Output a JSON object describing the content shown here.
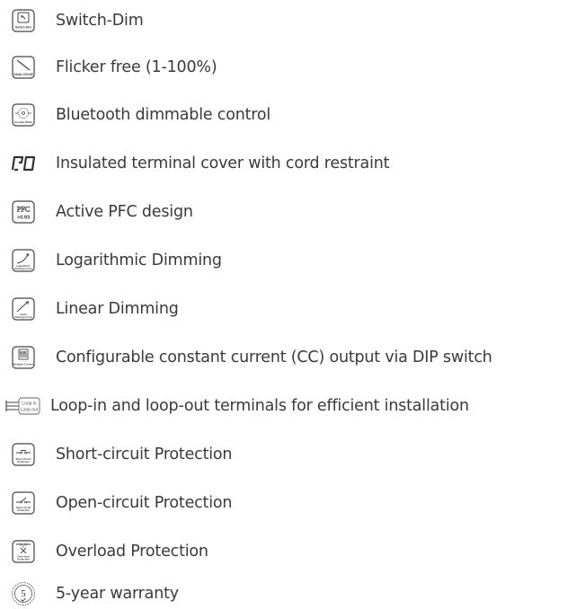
{
  "features": [
    {
      "icon": "switch-dim-icon",
      "icon_text": "Switch-Dim",
      "text": "Switch-Dim"
    },
    {
      "icon": "analogue-icon",
      "icon_text": "ANALOGUE",
      "text": "Flicker free (1-100%)"
    },
    {
      "icon": "bluetooth-tunable-white-icon",
      "icon_text": "Tunable White",
      "text": "Bluetooth dimmable control"
    },
    {
      "icon": "terminal-cover-icon",
      "icon_text": "",
      "text": "Insulated terminal cover with cord restraint"
    },
    {
      "icon": "pfc-icon",
      "icon_text": ">0.93",
      "text": "Active PFC design"
    },
    {
      "icon": "logarithmic-curve-icon",
      "icon_text": "Logarithmic Dimming Curve",
      "text": "Logarithmic Dimming"
    },
    {
      "icon": "linear-curve-icon",
      "icon_text": "Linear Dimming Curve",
      "text": "Linear Dimming"
    },
    {
      "icon": "dip-switch-icon",
      "icon_text": "Multiple Current",
      "text": "Configurable constant current (CC) output via DIP switch"
    },
    {
      "icon": "loop-in-out-icon",
      "icon_text": "Loop in Loop out",
      "text": "Loop-in and loop-out terminals for efficient installation"
    },
    {
      "icon": "short-circuit-icon",
      "icon_text": "Short Circuit Protection",
      "text": "Short-circuit Protection"
    },
    {
      "icon": "open-circuit-icon",
      "icon_text": "Open-circuit Protection",
      "text": "Open-circuit Protection"
    },
    {
      "icon": "overload-icon",
      "icon_text": "Over-load Protection",
      "text": "Overload Protection"
    },
    {
      "icon": "warranty-5-year-icon",
      "icon_text": "5",
      "text": "5-year warranty"
    }
  ]
}
